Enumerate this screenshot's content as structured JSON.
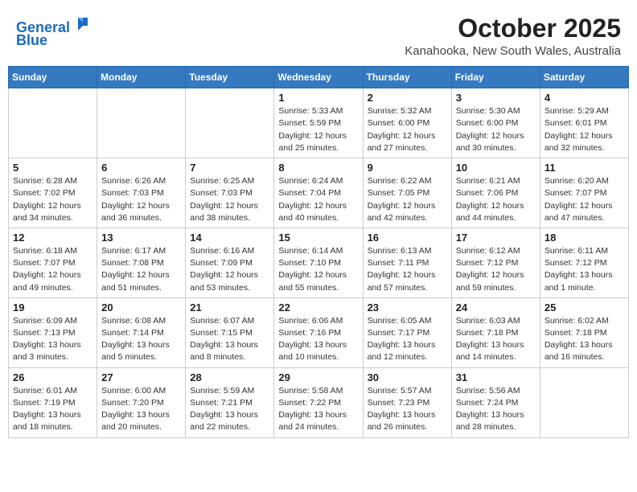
{
  "header": {
    "logo_line1": "General",
    "logo_line2": "Blue",
    "title": "October 2025",
    "subtitle": "Kanahooka, New South Wales, Australia"
  },
  "weekdays": [
    "Sunday",
    "Monday",
    "Tuesday",
    "Wednesday",
    "Thursday",
    "Friday",
    "Saturday"
  ],
  "weeks": [
    [
      {
        "day": "",
        "info": ""
      },
      {
        "day": "",
        "info": ""
      },
      {
        "day": "",
        "info": ""
      },
      {
        "day": "1",
        "info": "Sunrise: 5:33 AM\nSunset: 5:59 PM\nDaylight: 12 hours\nand 25 minutes."
      },
      {
        "day": "2",
        "info": "Sunrise: 5:32 AM\nSunset: 6:00 PM\nDaylight: 12 hours\nand 27 minutes."
      },
      {
        "day": "3",
        "info": "Sunrise: 5:30 AM\nSunset: 6:00 PM\nDaylight: 12 hours\nand 30 minutes."
      },
      {
        "day": "4",
        "info": "Sunrise: 5:29 AM\nSunset: 6:01 PM\nDaylight: 12 hours\nand 32 minutes."
      }
    ],
    [
      {
        "day": "5",
        "info": "Sunrise: 6:28 AM\nSunset: 7:02 PM\nDaylight: 12 hours\nand 34 minutes."
      },
      {
        "day": "6",
        "info": "Sunrise: 6:26 AM\nSunset: 7:03 PM\nDaylight: 12 hours\nand 36 minutes."
      },
      {
        "day": "7",
        "info": "Sunrise: 6:25 AM\nSunset: 7:03 PM\nDaylight: 12 hours\nand 38 minutes."
      },
      {
        "day": "8",
        "info": "Sunrise: 6:24 AM\nSunset: 7:04 PM\nDaylight: 12 hours\nand 40 minutes."
      },
      {
        "day": "9",
        "info": "Sunrise: 6:22 AM\nSunset: 7:05 PM\nDaylight: 12 hours\nand 42 minutes."
      },
      {
        "day": "10",
        "info": "Sunrise: 6:21 AM\nSunset: 7:06 PM\nDaylight: 12 hours\nand 44 minutes."
      },
      {
        "day": "11",
        "info": "Sunrise: 6:20 AM\nSunset: 7:07 PM\nDaylight: 12 hours\nand 47 minutes."
      }
    ],
    [
      {
        "day": "12",
        "info": "Sunrise: 6:18 AM\nSunset: 7:07 PM\nDaylight: 12 hours\nand 49 minutes."
      },
      {
        "day": "13",
        "info": "Sunrise: 6:17 AM\nSunset: 7:08 PM\nDaylight: 12 hours\nand 51 minutes."
      },
      {
        "day": "14",
        "info": "Sunrise: 6:16 AM\nSunset: 7:09 PM\nDaylight: 12 hours\nand 53 minutes."
      },
      {
        "day": "15",
        "info": "Sunrise: 6:14 AM\nSunset: 7:10 PM\nDaylight: 12 hours\nand 55 minutes."
      },
      {
        "day": "16",
        "info": "Sunrise: 6:13 AM\nSunset: 7:11 PM\nDaylight: 12 hours\nand 57 minutes."
      },
      {
        "day": "17",
        "info": "Sunrise: 6:12 AM\nSunset: 7:12 PM\nDaylight: 12 hours\nand 59 minutes."
      },
      {
        "day": "18",
        "info": "Sunrise: 6:11 AM\nSunset: 7:12 PM\nDaylight: 13 hours\nand 1 minute."
      }
    ],
    [
      {
        "day": "19",
        "info": "Sunrise: 6:09 AM\nSunset: 7:13 PM\nDaylight: 13 hours\nand 3 minutes."
      },
      {
        "day": "20",
        "info": "Sunrise: 6:08 AM\nSunset: 7:14 PM\nDaylight: 13 hours\nand 5 minutes."
      },
      {
        "day": "21",
        "info": "Sunrise: 6:07 AM\nSunset: 7:15 PM\nDaylight: 13 hours\nand 8 minutes."
      },
      {
        "day": "22",
        "info": "Sunrise: 6:06 AM\nSunset: 7:16 PM\nDaylight: 13 hours\nand 10 minutes."
      },
      {
        "day": "23",
        "info": "Sunrise: 6:05 AM\nSunset: 7:17 PM\nDaylight: 13 hours\nand 12 minutes."
      },
      {
        "day": "24",
        "info": "Sunrise: 6:03 AM\nSunset: 7:18 PM\nDaylight: 13 hours\nand 14 minutes."
      },
      {
        "day": "25",
        "info": "Sunrise: 6:02 AM\nSunset: 7:18 PM\nDaylight: 13 hours\nand 16 minutes."
      }
    ],
    [
      {
        "day": "26",
        "info": "Sunrise: 6:01 AM\nSunset: 7:19 PM\nDaylight: 13 hours\nand 18 minutes."
      },
      {
        "day": "27",
        "info": "Sunrise: 6:00 AM\nSunset: 7:20 PM\nDaylight: 13 hours\nand 20 minutes."
      },
      {
        "day": "28",
        "info": "Sunrise: 5:59 AM\nSunset: 7:21 PM\nDaylight: 13 hours\nand 22 minutes."
      },
      {
        "day": "29",
        "info": "Sunrise: 5:58 AM\nSunset: 7:22 PM\nDaylight: 13 hours\nand 24 minutes."
      },
      {
        "day": "30",
        "info": "Sunrise: 5:57 AM\nSunset: 7:23 PM\nDaylight: 13 hours\nand 26 minutes."
      },
      {
        "day": "31",
        "info": "Sunrise: 5:56 AM\nSunset: 7:24 PM\nDaylight: 13 hours\nand 28 minutes."
      },
      {
        "day": "",
        "info": ""
      }
    ]
  ]
}
